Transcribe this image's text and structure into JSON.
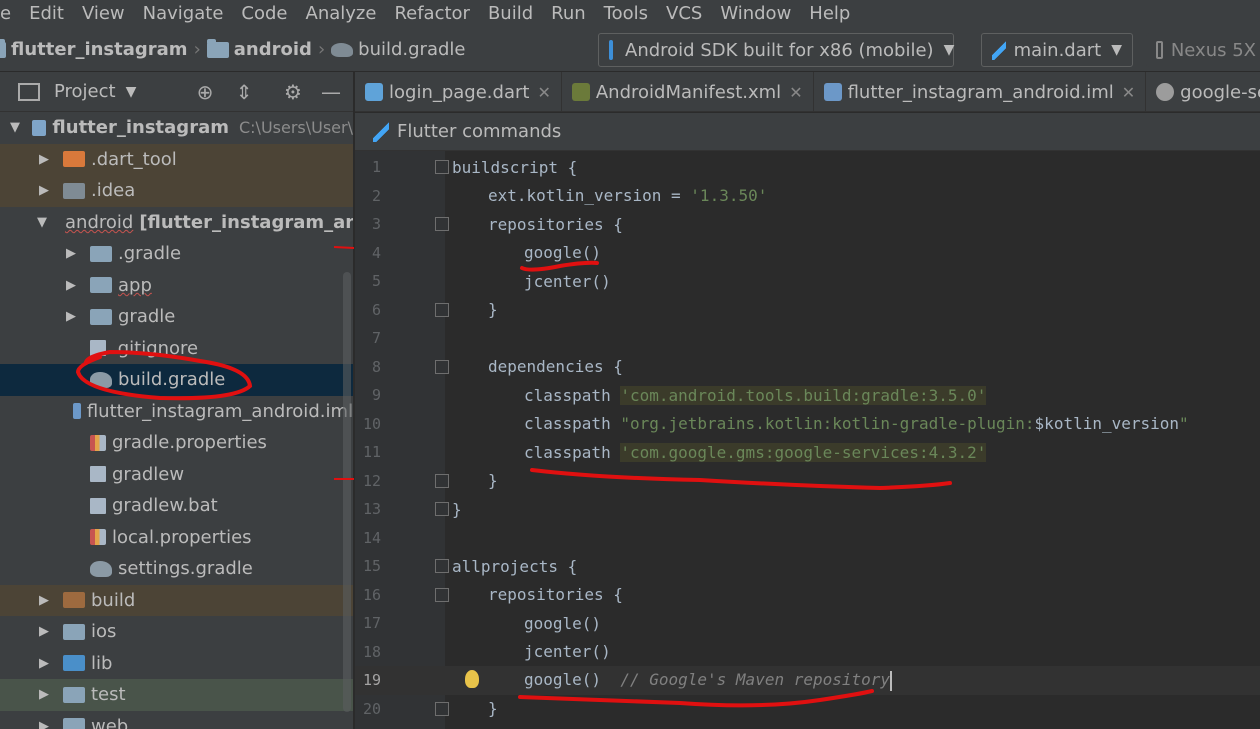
{
  "menu": [
    "e",
    "Edit",
    "View",
    "Navigate",
    "Code",
    "Analyze",
    "Refactor",
    "Build",
    "Run",
    "Tools",
    "VCS",
    "Window",
    "Help"
  ],
  "breadcrumb": {
    "project": "flutter_instagram",
    "folder": "android",
    "file": "build.gradle"
  },
  "toolbar": {
    "device_combo": "Android SDK built for x86 (mobile)",
    "run_config": "main.dart",
    "device2": "Nexus 5X"
  },
  "project_panel": {
    "title": "Project",
    "tree": [
      {
        "label": "flutter_instagram",
        "extra": "C:\\Users\\User\\",
        "indent": 0,
        "toggle": "open",
        "icon": "module",
        "bold": true
      },
      {
        "label": ".dart_tool",
        "indent": 1,
        "toggle": "closed",
        "icon": "folder-orange",
        "style": "excluded"
      },
      {
        "label": ".idea",
        "indent": 1,
        "toggle": "closed",
        "icon": "idea",
        "style": "excluded"
      },
      {
        "label": "android",
        "extra": "[flutter_instagram_android]",
        "indent": 1,
        "toggle": "open",
        "icon": "module"
      },
      {
        "label": ".gradle",
        "indent": 2,
        "toggle": "closed",
        "icon": "folder"
      },
      {
        "label": "app",
        "indent": 2,
        "toggle": "closed",
        "icon": "folder"
      },
      {
        "label": "gradle",
        "indent": 2,
        "toggle": "closed",
        "icon": "folder"
      },
      {
        "label": ".gitignore",
        "indent": 2,
        "toggle": "none",
        "icon": "file"
      },
      {
        "label": "build.gradle",
        "indent": 2,
        "toggle": "none",
        "icon": "gradle",
        "style": "selected"
      },
      {
        "label": "flutter_instagram_android.iml",
        "indent": 2,
        "toggle": "none",
        "icon": "iml"
      },
      {
        "label": "gradle.properties",
        "indent": 2,
        "toggle": "none",
        "icon": "props"
      },
      {
        "label": "gradlew",
        "indent": 2,
        "toggle": "none",
        "icon": "file"
      },
      {
        "label": "gradlew.bat",
        "indent": 2,
        "toggle": "none",
        "icon": "file"
      },
      {
        "label": "local.properties",
        "indent": 2,
        "toggle": "none",
        "icon": "props"
      },
      {
        "label": "settings.gradle",
        "indent": 2,
        "toggle": "none",
        "icon": "gradle"
      },
      {
        "label": "build",
        "indent": 1,
        "toggle": "closed",
        "icon": "folder-excl",
        "style": "excluded"
      },
      {
        "label": "ios",
        "indent": 1,
        "toggle": "closed",
        "icon": "folder"
      },
      {
        "label": "lib",
        "indent": 1,
        "toggle": "closed",
        "icon": "folder-blue"
      },
      {
        "label": "test",
        "indent": 1,
        "toggle": "closed",
        "icon": "folder",
        "style": "test"
      },
      {
        "label": "web",
        "indent": 1,
        "toggle": "closed",
        "icon": "folder"
      }
    ]
  },
  "tabs": [
    {
      "label": "login_page.dart",
      "icon": "dart"
    },
    {
      "label": "AndroidManifest.xml",
      "icon": "xml"
    },
    {
      "label": "flutter_instagram_android.iml",
      "icon": "iml"
    },
    {
      "label": "google-services.json",
      "icon": "json"
    }
  ],
  "flutter_commands": "Flutter commands",
  "code_lines": [
    {
      "n": "1",
      "parts": [
        {
          "t": "buildscript {",
          "c": ""
        }
      ],
      "indent": 0
    },
    {
      "n": "2",
      "parts": [
        {
          "t": "ext.kotlin_version = ",
          "c": ""
        },
        {
          "t": "'1.3.50'",
          "c": "str"
        }
      ],
      "indent": 1
    },
    {
      "n": "3",
      "parts": [
        {
          "t": "repositories {",
          "c": ""
        }
      ],
      "indent": 1
    },
    {
      "n": "4",
      "parts": [
        {
          "t": "google()",
          "c": ""
        }
      ],
      "indent": 2
    },
    {
      "n": "5",
      "parts": [
        {
          "t": "jcenter()",
          "c": ""
        }
      ],
      "indent": 2
    },
    {
      "n": "6",
      "parts": [
        {
          "t": "}",
          "c": ""
        }
      ],
      "indent": 1
    },
    {
      "n": "7",
      "parts": [],
      "indent": 0
    },
    {
      "n": "8",
      "parts": [
        {
          "t": "dependencies {",
          "c": ""
        }
      ],
      "indent": 1
    },
    {
      "n": "9",
      "parts": [
        {
          "t": "classpath ",
          "c": ""
        },
        {
          "t": "'com.android.tools.build:gradle:3.5.0'",
          "c": "str-hl"
        }
      ],
      "indent": 2
    },
    {
      "n": "10",
      "parts": [
        {
          "t": "classpath ",
          "c": ""
        },
        {
          "t": "\"org.jetbrains.kotlin:kotlin-gradle-plugin:",
          "c": "str"
        },
        {
          "t": "$kotlin_version",
          "c": ""
        },
        {
          "t": "\"",
          "c": "str"
        }
      ],
      "indent": 2
    },
    {
      "n": "11",
      "parts": [
        {
          "t": "classpath ",
          "c": ""
        },
        {
          "t": "'com.google.gms:google-services:4.3.2'",
          "c": "str-hl"
        }
      ],
      "indent": 2
    },
    {
      "n": "12",
      "parts": [
        {
          "t": "}",
          "c": ""
        }
      ],
      "indent": 1
    },
    {
      "n": "13",
      "parts": [
        {
          "t": "}",
          "c": ""
        }
      ],
      "indent": 0
    },
    {
      "n": "14",
      "parts": [],
      "indent": 0
    },
    {
      "n": "15",
      "parts": [
        {
          "t": "allprojects {",
          "c": ""
        }
      ],
      "indent": 0
    },
    {
      "n": "16",
      "parts": [
        {
          "t": "repositories {",
          "c": ""
        }
      ],
      "indent": 1
    },
    {
      "n": "17",
      "parts": [
        {
          "t": "google()",
          "c": ""
        }
      ],
      "indent": 2
    },
    {
      "n": "18",
      "parts": [
        {
          "t": "jcenter()",
          "c": ""
        }
      ],
      "indent": 2
    },
    {
      "n": "19",
      "parts": [
        {
          "t": "google()  ",
          "c": ""
        },
        {
          "t": "// Google's Maven repository",
          "c": "cmt"
        }
      ],
      "indent": 2,
      "current": true
    },
    {
      "n": "20",
      "parts": [
        {
          "t": "}",
          "c": ""
        }
      ],
      "indent": 1
    }
  ]
}
